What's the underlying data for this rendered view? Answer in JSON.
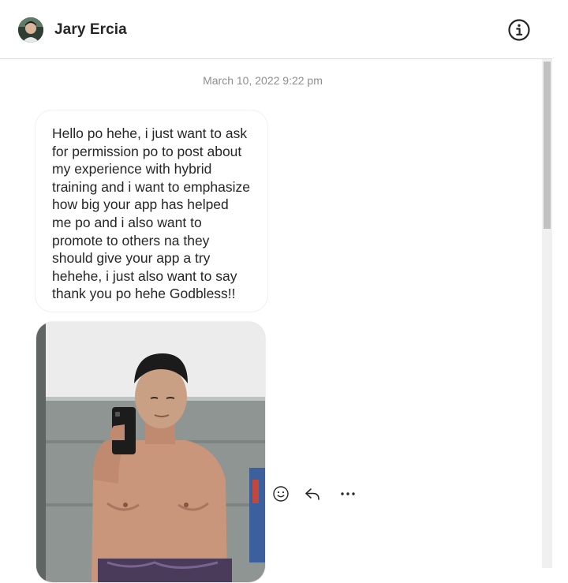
{
  "header": {
    "contact_name": "Jary Ercia",
    "avatar_icon": "profile-avatar",
    "info_icon": "info-circle-icon"
  },
  "thread": {
    "timestamp": "March 10, 2022 9:22 pm",
    "messages": [
      {
        "type": "text",
        "text": "Hello po hehe, i just want to ask\nfor permission po to post about\nmy experience with hybrid\ntraining and i want to emphasize\nhow big your app has helped\nme po and i also want to\npromote to others na they\nshould give your app a try\nhehehe, i just also want to say\nthank you po hehe Godbless!!"
      },
      {
        "type": "image",
        "image_icon": "mirror-selfie-photo"
      }
    ],
    "message_actions": [
      {
        "name": "react",
        "icon": "smiley-icon"
      },
      {
        "name": "reply",
        "icon": "reply-arrow-icon"
      },
      {
        "name": "more",
        "icon": "more-dots-icon"
      }
    ]
  },
  "colors": {
    "text": "#262626",
    "muted": "#8e8e8e",
    "border": "#dbdbdb",
    "bubble_border": "#efefef"
  }
}
